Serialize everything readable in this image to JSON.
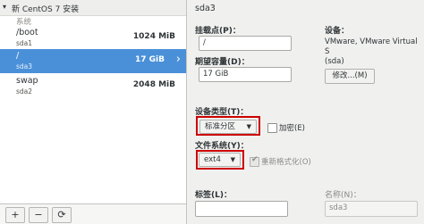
{
  "left": {
    "title": "新 CentOS 7 安装",
    "group": "系统",
    "partitions": [
      {
        "mount": "/boot",
        "device": "sda1",
        "size": "1024 MiB"
      },
      {
        "mount": "/",
        "device": "sda3",
        "size": "17 GiB"
      },
      {
        "mount": "swap",
        "device": "sda2",
        "size": "2048 MiB"
      }
    ],
    "tools": {
      "add": "+",
      "remove": "−",
      "refresh": "⟳"
    }
  },
  "right": {
    "title": "sda3",
    "mount_label": "挂载点(P)：",
    "mount_value": "/",
    "capacity_label": "期望容量(D)：",
    "capacity_value": "17 GiB",
    "device_label": "设备：",
    "device_value_line1": "VMware, VMware Virtual S",
    "device_value_line2": "(sda)",
    "modify_button": "修改...(M)",
    "device_type_label": "设备类型(T)：",
    "device_type_value": "标准分区",
    "encrypt_label": "加密(E)",
    "fs_label": "文件系统(Y)：",
    "fs_value": "ext4",
    "reformat_label": "重新格式化(O)",
    "tag_label": "标签(L)：",
    "tag_value": "",
    "name_label": "名称(N)：",
    "name_value": "sda3"
  },
  "colors": {
    "selection": "#4a90d9",
    "highlight": "#cc0000"
  }
}
